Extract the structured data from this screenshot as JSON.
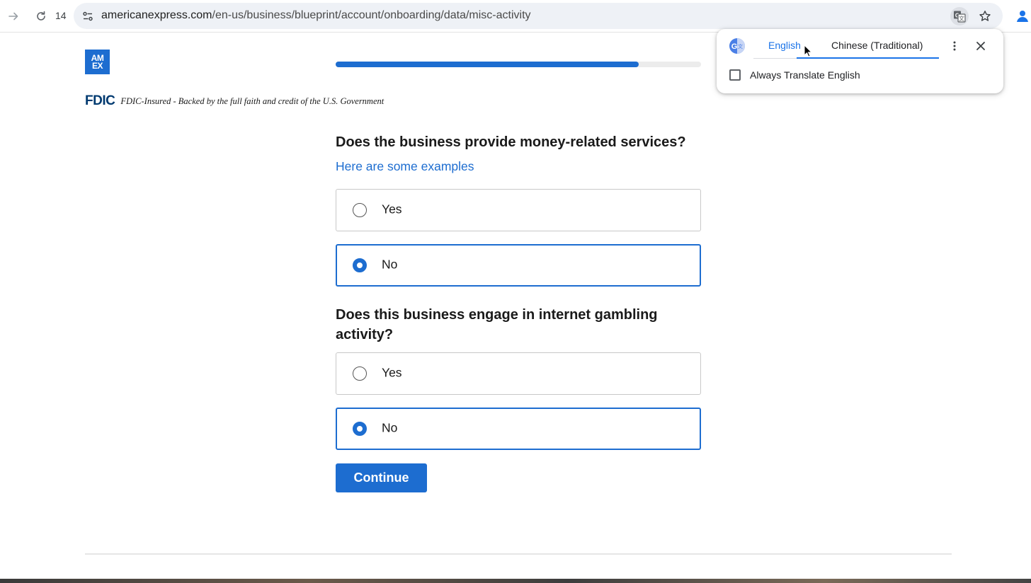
{
  "browser": {
    "tab_count": "14",
    "url_domain": "americanexpress.com",
    "url_path": "/en-us/business/blueprint/account/onboarding/data/misc-activity"
  },
  "translate_popup": {
    "source_language": "English",
    "target_language": "Chinese (Traditional)",
    "always_translate_label": "Always Translate English",
    "always_translate_checked": false
  },
  "page": {
    "logo_text_line1": "AM",
    "logo_text_line2": "EX",
    "progress": 0.83,
    "fdic_logo": "FDIC",
    "fdic_text": "FDIC-Insured - Backed by the full faith and credit of the U.S. Government",
    "question1": {
      "text": "Does the business provide money-related services?",
      "link": "Here are some examples",
      "options": [
        {
          "label": "Yes",
          "selected": false
        },
        {
          "label": "No",
          "selected": true
        }
      ]
    },
    "question2": {
      "text": "Does this business engage in internet gambling activity?",
      "options": [
        {
          "label": "Yes",
          "selected": false
        },
        {
          "label": "No",
          "selected": true
        }
      ]
    },
    "continue_label": "Continue"
  },
  "colors": {
    "accent": "#1d6dd0",
    "translate_blue": "#1a73e8"
  }
}
